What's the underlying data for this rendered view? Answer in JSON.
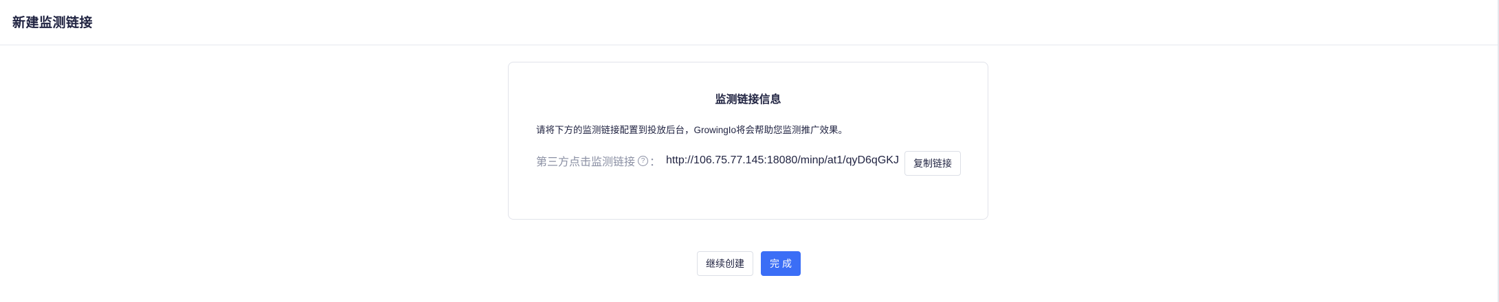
{
  "header": {
    "title": "新建监测链接"
  },
  "card": {
    "title": "监测链接信息",
    "description": "请将下方的监测链接配置到投放后台，GrowingIo将会帮助您监测推广效果。",
    "link_label": "第三方点击监测链接",
    "help_icon_glyph": "?",
    "colon": "：",
    "link_url": "http://106.75.77.145:18080/minp/at1/qyD6qGKJ",
    "copy_button_label": "复制链接"
  },
  "footer": {
    "continue_label": "继续创建",
    "done_label": "完成"
  },
  "colors": {
    "primary": "#3b6ef6",
    "text": "#1f2240",
    "muted": "#8a8fa3",
    "border": "#dcdfe6"
  }
}
